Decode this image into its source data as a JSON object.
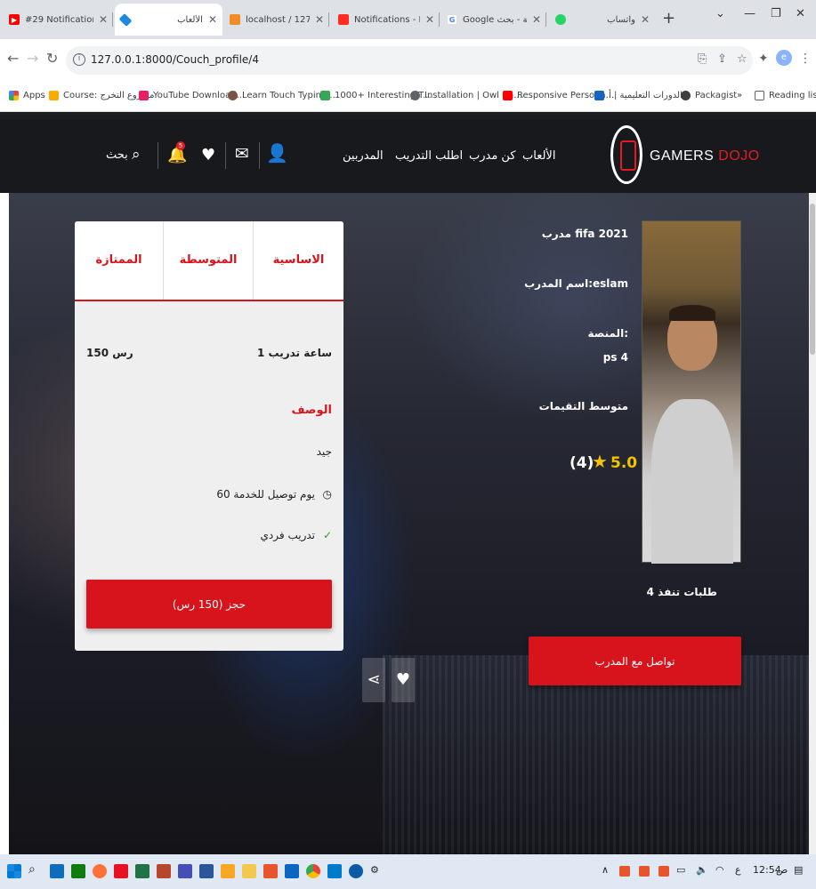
{
  "browser": {
    "tabs": [
      {
        "title": "#29 Notification Part",
        "favicon_color": "#ff0000"
      },
      {
        "title": "الألعاب",
        "favicon_color": "#1e88e5"
      },
      {
        "title": "localhost / 127.0.0.1 /",
        "favicon_color": "#f28c28"
      },
      {
        "title": "Notifications - Laravel",
        "favicon_color": "#ff2d20"
      },
      {
        "title": "Google ترجمة - بحث",
        "favicon_color": "#4285f4"
      },
      {
        "title": "واتساب",
        "favicon_color": "#25d366"
      }
    ],
    "url": "127.0.0.1:8000/Couch_profile/4",
    "profile_initial": "e",
    "bookmarks": [
      {
        "label": "Apps",
        "color": "#ea4335"
      },
      {
        "label": "Course: مشروع التخرج",
        "color": "#f9ab00"
      },
      {
        "label": "YouTube Download...",
        "color": "#e91e63"
      },
      {
        "label": "Learn Touch Typing...",
        "color": "#795548"
      },
      {
        "label": "1000+ Interesting T...",
        "color": "#34a853"
      },
      {
        "label": "Installation | Owl Ca...",
        "color": "#5f6368"
      },
      {
        "label": "Responsive Persona...",
        "color": "#ff0000"
      },
      {
        "label": "الدورات التعليمية | أ...",
        "color": "#1565c0"
      },
      {
        "label": "Packagist",
        "color": "#3c4043"
      }
    ],
    "reading_list": "Reading list",
    "more_bookmarks": "»"
  },
  "site": {
    "logo": {
      "word1": "GAMERS",
      "word2": "DOJO",
      "accent": "#e31b23"
    },
    "nav": {
      "games": "الألعاب",
      "be_coach": "كن مدرب",
      "request": "اطلب التدريب",
      "coaches": "المدربين"
    },
    "search_label": "بحث",
    "notification_count": "5"
  },
  "coach": {
    "game": "مدرب fifa 2021",
    "name": "اسم المدرب:eslam",
    "platform_label": "المنصة:",
    "platform": "ps 4",
    "avg_rating_label": "متوسط التقيمات",
    "rating": "5.0",
    "rating_count": "(4)",
    "orders": "4 طلبات تنفذ",
    "contact_button": "تواصل مع المدرب"
  },
  "pricing": {
    "tabs": [
      "الاساسية",
      "المتوسطة",
      "الممتازة"
    ],
    "duration": "1 ساعة تدريب",
    "price": "150 رس",
    "description_label": "الوصف",
    "description": "جيد",
    "delivery": "60 يوم توصيل للخدمة",
    "type": "تدريب فردي",
    "book_button": "حجز (150 رس)"
  },
  "taskbar": {
    "time": "12:54",
    "ampm": "ص",
    "lang": "ع"
  },
  "colors": {
    "brand_red": "#d7141b",
    "star": "#f2c300",
    "header_bg": "#18191c"
  }
}
